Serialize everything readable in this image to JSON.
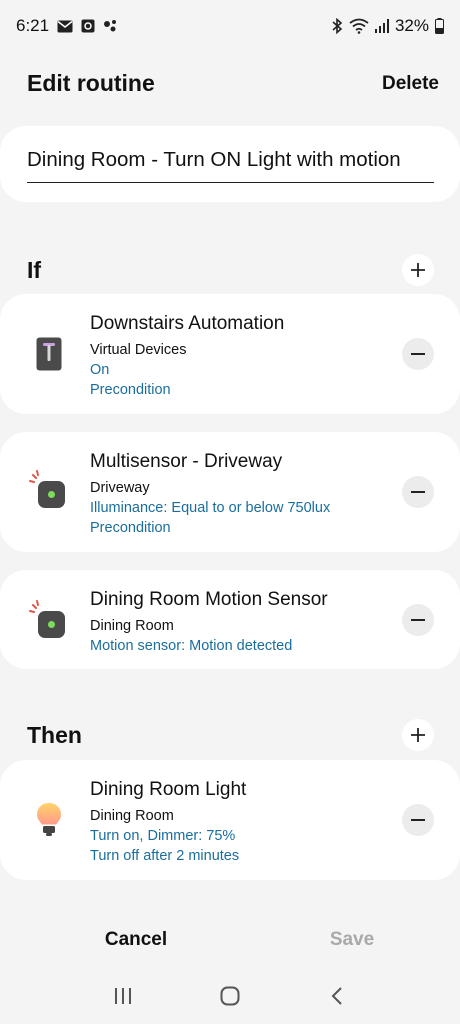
{
  "status_bar": {
    "time": "6:21",
    "battery": "32%",
    "icons": [
      "mail-icon",
      "screenshot-icon",
      "assistant-icon",
      "bluetooth-icon",
      "wifi-icon",
      "signal-icon",
      "battery-icon"
    ]
  },
  "header": {
    "title": "Edit routine",
    "delete_label": "Delete"
  },
  "routine_name": "Dining Room - Turn ON Light with motion",
  "if_section": {
    "title": "If",
    "items": [
      {
        "title": "Downstairs Automation",
        "subtitle": "Virtual Devices",
        "details": [
          "On",
          "Precondition"
        ],
        "icon": "virtual-switch-icon"
      },
      {
        "title": "Multisensor - Driveway",
        "subtitle": "Driveway",
        "details": [
          "Illuminance: Equal to or below 750lux",
          "Precondition"
        ],
        "icon": "motion-sensor-icon"
      },
      {
        "title": "Dining Room Motion Sensor",
        "subtitle": "Dining Room",
        "details": [
          "Motion sensor: Motion detected"
        ],
        "icon": "motion-sensor-icon"
      }
    ]
  },
  "then_section": {
    "title": "Then",
    "items": [
      {
        "title": "Dining Room Light",
        "subtitle": "Dining Room",
        "details": [
          "Turn on, Dimmer: 75%",
          "Turn off after 2 minutes"
        ],
        "icon": "light-bulb-icon"
      }
    ]
  },
  "actions": {
    "cancel_label": "Cancel",
    "save_label": "Save"
  },
  "colors": {
    "background": "#f4f4f4",
    "card": "#ffffff",
    "detail_text": "#1a6e9e",
    "disabled_text": "#a9a9a9"
  }
}
